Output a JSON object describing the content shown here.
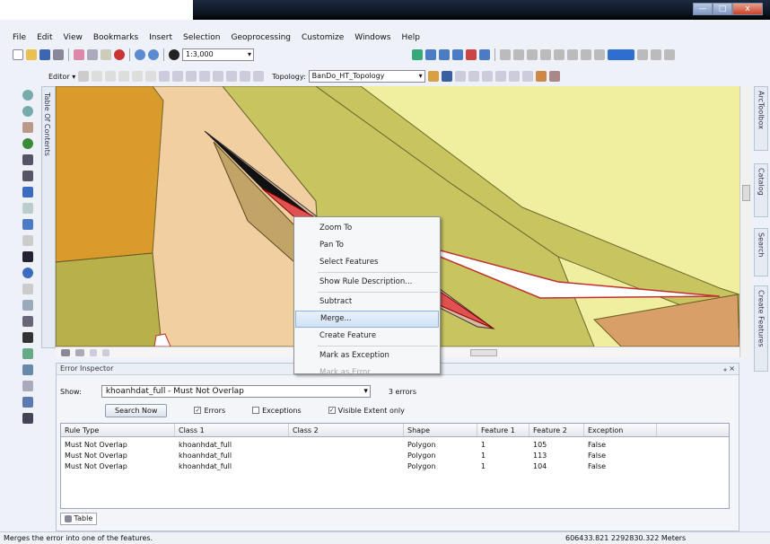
{
  "window": {
    "minimize": "—",
    "maximize": "□",
    "close": "x"
  },
  "menu": [
    "File",
    "Edit",
    "View",
    "Bookmarks",
    "Insert",
    "Selection",
    "Geoprocessing",
    "Customize",
    "Windows",
    "Help"
  ],
  "toolbar": {
    "scale": "1:3,000",
    "editor_label": "Editor ▾",
    "topology_label": "Topology:",
    "topology_value": "BanDo_HT_Topology"
  },
  "toc_label": "Table Of Contents",
  "right_tabs": [
    "ArcToolbox",
    "Catalog",
    "Search",
    "Create Features"
  ],
  "context_menu": {
    "items": [
      "Zoom To",
      "Pan To",
      "Select Features",
      "Show Rule Description...",
      "Subtract",
      "Merge...",
      "Create Feature",
      "Mark as Exception",
      "Mark as Error"
    ],
    "highlighted": "Merge...",
    "disabled": [
      "Mark as Error"
    ]
  },
  "error_inspector": {
    "title": "Error Inspector",
    "show_label": "Show:",
    "show_value": "khoanhdat_full - Must Not Overlap",
    "error_count": "3 errors",
    "search_button": "Search Now",
    "checks": [
      {
        "label": "Errors",
        "checked": true
      },
      {
        "label": "Exceptions",
        "checked": false
      },
      {
        "label": "Visible Extent only",
        "checked": true
      }
    ],
    "columns": [
      "Rule Type",
      "Class 1",
      "Class 2",
      "Shape",
      "Feature 1",
      "Feature 2",
      "Exception"
    ],
    "rows": [
      [
        "Must Not Overlap",
        "khoanhdat_full",
        "",
        "Polygon",
        "1",
        "105",
        "False"
      ],
      [
        "Must Not Overlap",
        "khoanhdat_full",
        "",
        "Polygon",
        "1",
        "113",
        "False"
      ],
      [
        "Must Not Overlap",
        "khoanhdat_full",
        "",
        "Polygon",
        "1",
        "104",
        "False"
      ]
    ],
    "table_tab": "Table"
  },
  "status": {
    "message": "Merges the error into one of the features.",
    "coords": "606433.821  2292830.322 Meters"
  },
  "colors": {
    "map_bg": "#f0efa0",
    "parcel_olive": "#c8c560",
    "parcel_peach": "#f2cfa0",
    "parcel_brown": "#d99c2c",
    "error_red": "#e05252",
    "highlight": "#cfe1f6"
  }
}
